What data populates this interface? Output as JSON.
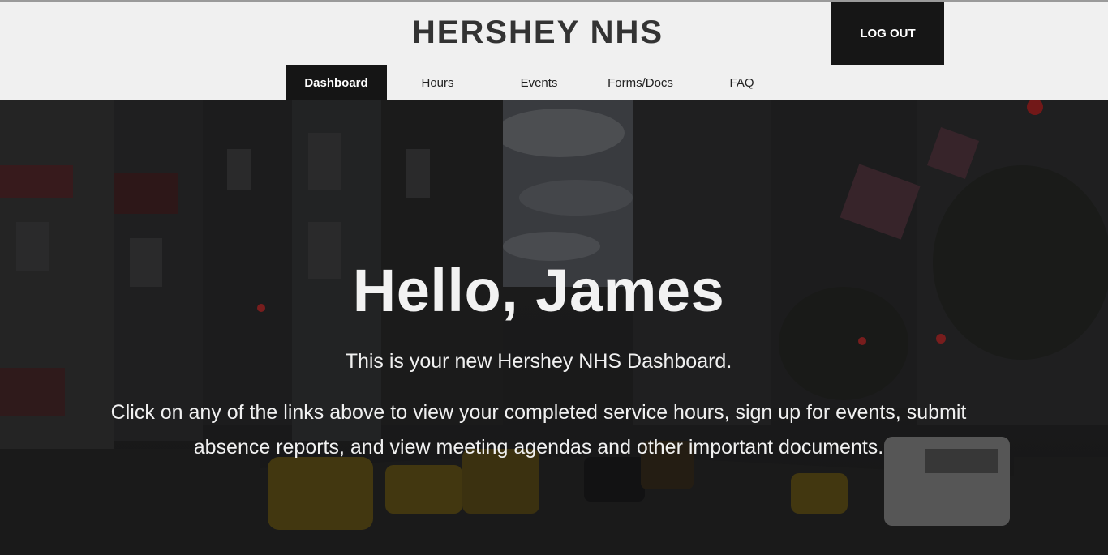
{
  "header": {
    "site_title": "HERSHEY NHS",
    "logout_label": "LOG OUT"
  },
  "nav": {
    "items": [
      {
        "label": "Dashboard",
        "active": true
      },
      {
        "label": "Hours",
        "active": false
      },
      {
        "label": "Events",
        "active": false
      },
      {
        "label": "Forms/Docs",
        "active": false
      },
      {
        "label": "FAQ",
        "active": false
      }
    ]
  },
  "hero": {
    "greeting": "Hello, James",
    "subtitle": "This is your new Hershey NHS Dashboard.",
    "body": "Click on any of the links above to view your completed service hours, sign up for events, submit absence reports, and view meeting agendas and other important documents."
  },
  "colors": {
    "header_bg": "#f0f0f0",
    "active_nav_bg": "#151515",
    "logout_bg": "#161616",
    "title_color": "#333333",
    "hero_text": "#f2f2f2"
  }
}
